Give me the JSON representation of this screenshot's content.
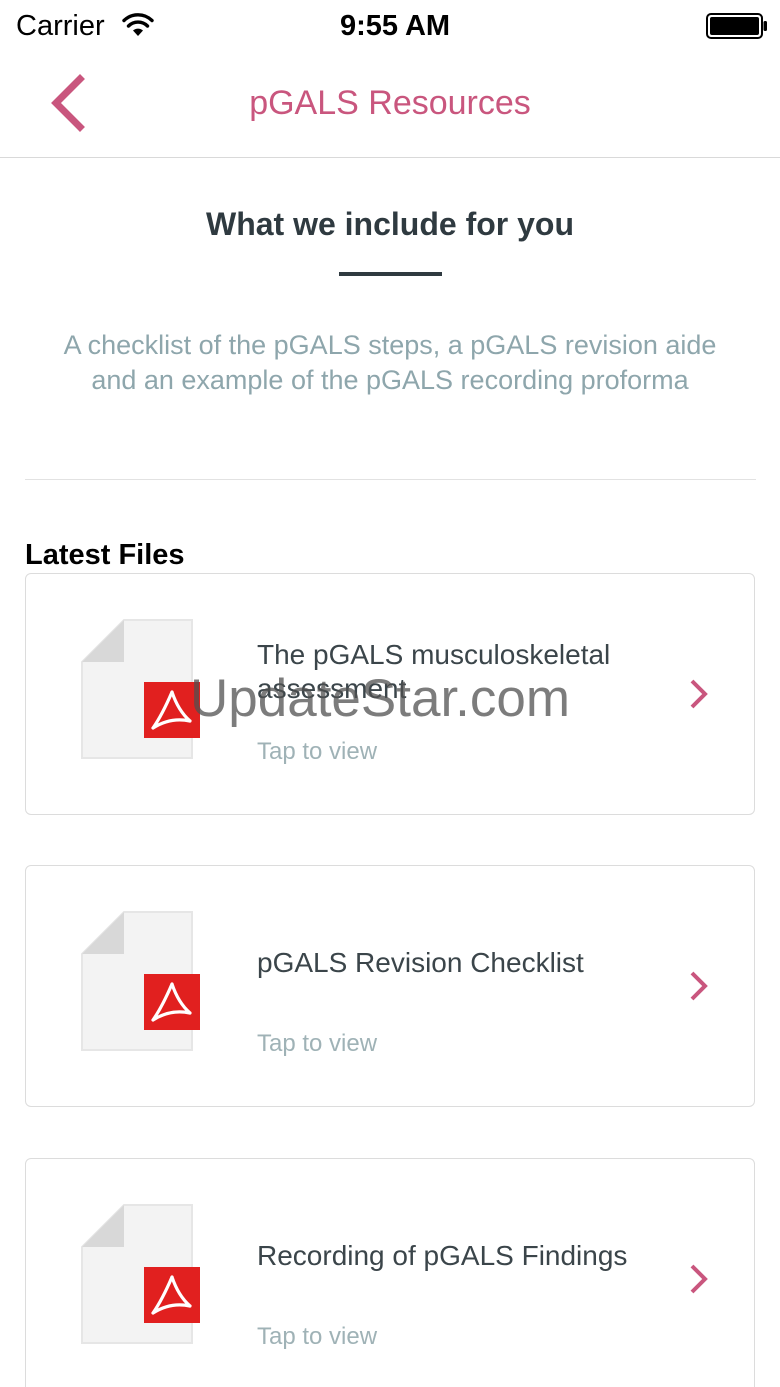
{
  "status_bar": {
    "carrier": "Carrier",
    "time": "9:55 AM"
  },
  "nav": {
    "title": "pGALS Resources",
    "back_icon": "chevron-left-icon"
  },
  "intro": {
    "heading": "What we include for you",
    "description": "A checklist of the pGALS steps, a pGALS revision aide and an example of the pGALS recording proforma"
  },
  "files": {
    "title": "Latest Files",
    "items": [
      {
        "name": "The pGALS musculoskeletal assessment",
        "subtitle": "Tap to view",
        "icon": "pdf-file-icon"
      },
      {
        "name": "pGALS Revision Checklist",
        "subtitle": "Tap to view",
        "icon": "pdf-file-icon"
      },
      {
        "name": "Recording of pGALS Findings",
        "subtitle": "Tap to view",
        "icon": "pdf-file-icon"
      }
    ]
  },
  "watermark": "UpdateStar.com",
  "colors": {
    "accent": "#c9567e",
    "pdf_red": "#e1201f",
    "heading": "#2f3a40",
    "muted_text": "#8ea6ac"
  }
}
